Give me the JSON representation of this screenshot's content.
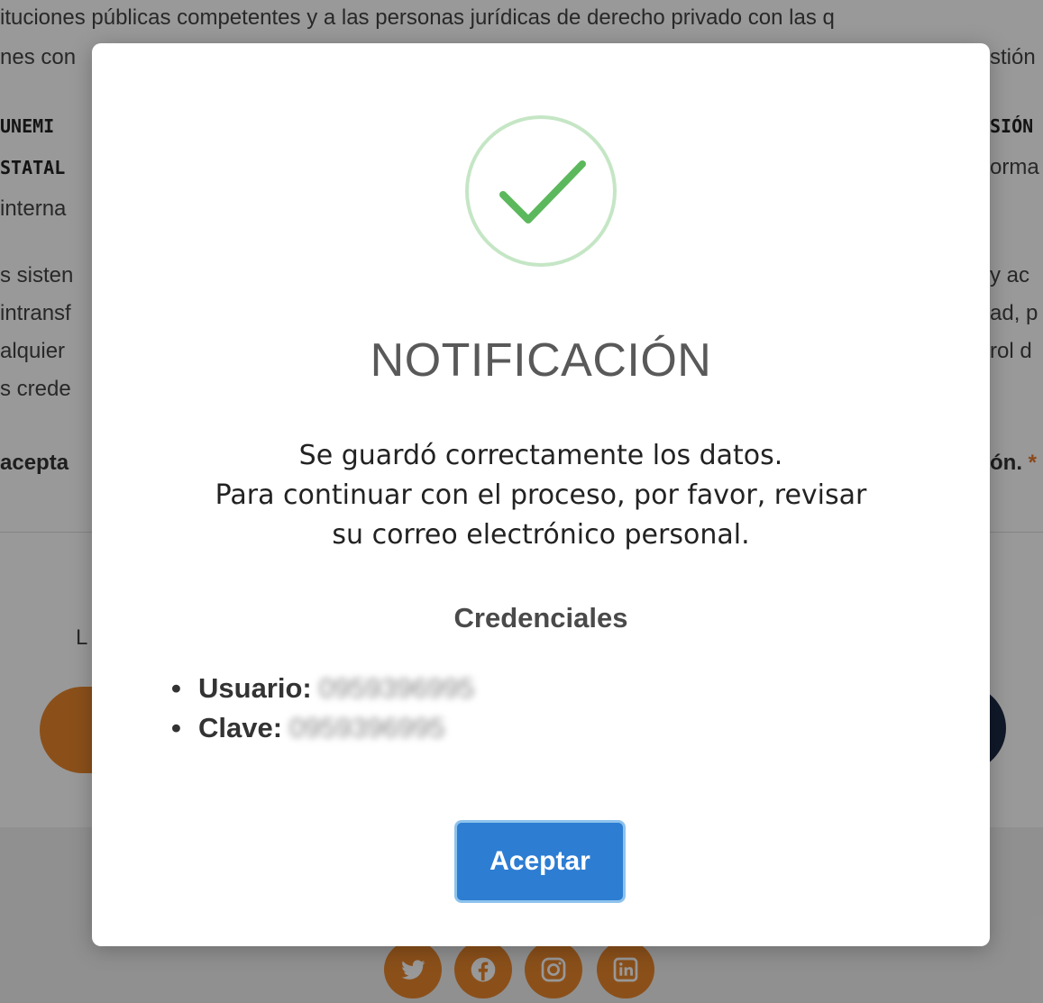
{
  "background": {
    "lines": [
      "ituciones públicas competentes y a las personas jurídicas de derecho privado con las q",
      "nes con",
      "stión"
    ],
    "left_fragments": [
      "UNEMI",
      "STATAL",
      " interna",
      "s sisten",
      "intransf",
      "alquier",
      "s crede",
      "acepta"
    ],
    "right_fragments": [
      "SIÓN",
      "orma",
      "y ac",
      "ad, p",
      "rol d",
      "ón."
    ],
    "required_mark": "*",
    "login_label": "L"
  },
  "modal": {
    "icon": "check-circle-icon",
    "title": "NOTIFICACIÓN",
    "message_lines": [
      "Se guardó correctamente los datos.",
      "Para continuar con el proceso, por favor, revisar",
      "su correo electrónico personal."
    ],
    "credentials_title": "Credenciales",
    "credentials": {
      "user_label": "Usuario:",
      "user_value": "0959396995",
      "password_label": "Clave:",
      "password_value": "0959396995"
    },
    "accept_label": "Aceptar"
  },
  "footer": {
    "social_icons": [
      "twitter-icon",
      "facebook-icon",
      "instagram-icon",
      "linkedin-icon"
    ]
  },
  "colors": {
    "accent_orange": "#e8852c",
    "success_green": "#5cb85c",
    "button_blue": "#2d7dd2"
  }
}
